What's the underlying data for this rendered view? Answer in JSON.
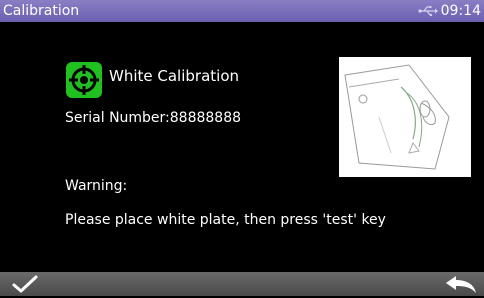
{
  "window": {
    "title": "Calibration",
    "time": "09:14"
  },
  "content": {
    "heading": "White Calibration",
    "serial": "Serial Number:88888888",
    "warning_label": "Warning:",
    "warning_message": "Please place white plate, then press 'test' key"
  },
  "icons": {
    "status": "usb-icon",
    "calibration": "crosshair-icon",
    "confirm": "checkmark-icon",
    "back": "back-arrow-icon"
  },
  "colors": {
    "titlebar": "#7a6fbc",
    "icon_green": "#20c020",
    "bottombar": "#555555"
  }
}
